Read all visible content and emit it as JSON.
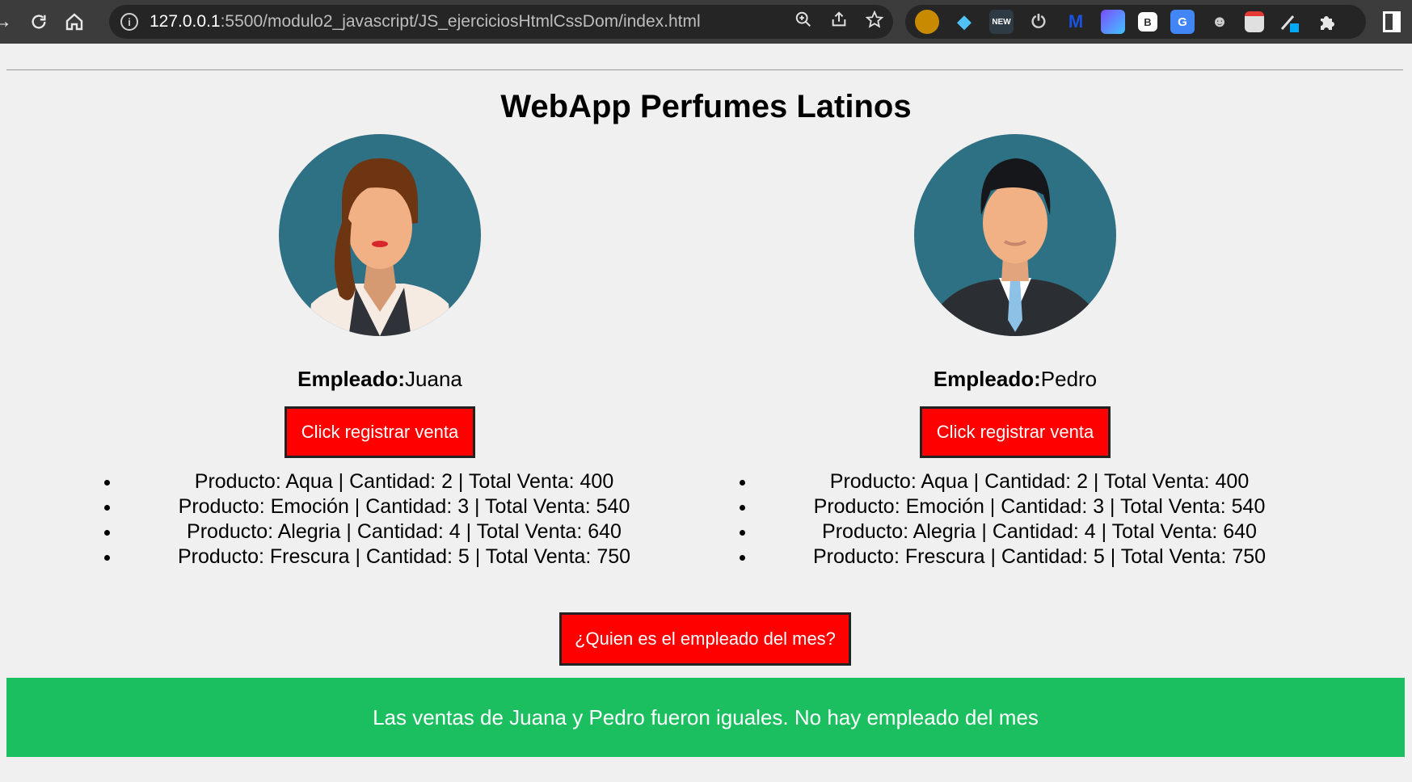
{
  "browser": {
    "url_host": "127.0.0.1",
    "url_path": ":5500/modulo2_javascript/JS_ejerciciosHtmlCssDom/index.html",
    "extensions": [
      {
        "icon": "honey-ext-icon",
        "label": "",
        "color": "#c88a00"
      },
      {
        "icon": "diamond-ext-icon",
        "label": "",
        "color": "#1e88e5"
      },
      {
        "icon": "new-ext-icon",
        "label": "NEW",
        "color": "#2e3b44"
      },
      {
        "icon": "power-ext-icon",
        "label": "⏻",
        "color": "#252525"
      },
      {
        "icon": "m-ext-icon",
        "label": "M",
        "color": "#1a53e0"
      },
      {
        "icon": "grid-ext-icon",
        "label": "",
        "color": "#7c4dff"
      },
      {
        "icon": "b-ext-icon",
        "label": "B",
        "color": "#ffffff"
      },
      {
        "icon": "translate-ext-icon",
        "label": "G",
        "color": "#4285f4"
      },
      {
        "icon": "cat-ext-icon",
        "label": "😺",
        "color": "#252525"
      },
      {
        "icon": "cast-ext-icon",
        "label": "",
        "color": "#e53935"
      },
      {
        "icon": "pen-ext-icon",
        "label": "",
        "color": "#00bcd4"
      },
      {
        "icon": "puzzle-ext-icon",
        "label": "🧩",
        "color": "#252525"
      }
    ]
  },
  "page": {
    "title": "WebApp Perfumes Latinos",
    "employee_label": "Empleado:",
    "register_button": "Click registrar venta",
    "employees": [
      {
        "name": "Juana",
        "sales": [
          "Producto: Aqua | Cantidad: 2 | Total Venta: 400",
          "Producto: Emoción | Cantidad: 3 | Total Venta: 540",
          "Producto: Alegria | Cantidad: 4 | Total Venta: 640",
          "Producto: Frescura | Cantidad: 5 | Total Venta: 750"
        ]
      },
      {
        "name": "Pedro",
        "sales": [
          "Producto: Aqua | Cantidad: 2 | Total Venta: 400",
          "Producto: Emoción | Cantidad: 3 | Total Venta: 540",
          "Producto: Alegria | Cantidad: 4 | Total Venta: 640",
          "Producto: Frescura | Cantidad: 5 | Total Venta: 750"
        ]
      }
    ],
    "month_button": "¿Quien es el empleado del mes?",
    "result_message": "Las ventas de Juana y Pedro fueron iguales. No hay empleado del mes"
  },
  "colors": {
    "button_red": "#ff0000",
    "result_green": "#1bbf60",
    "avatar_bg": "#2f7184"
  }
}
